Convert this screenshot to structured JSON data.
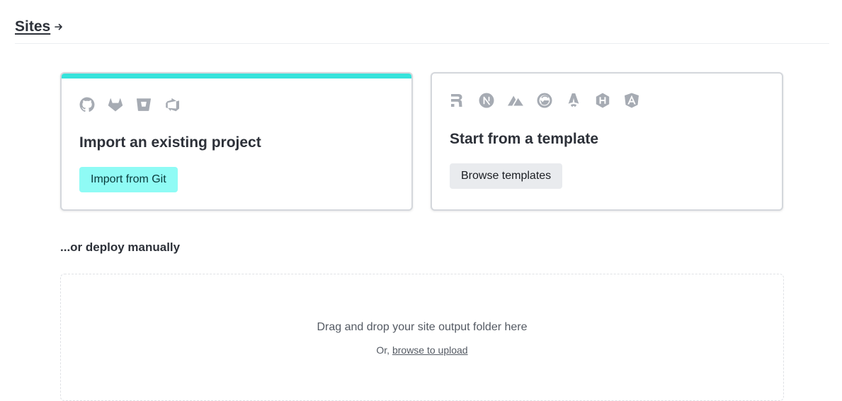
{
  "breadcrumb": {
    "label": "Sites",
    "arrow_icon": "arrow-right-icon"
  },
  "import_card": {
    "accent_color": "#36e3db",
    "icons": [
      "github-icon",
      "gitlab-icon",
      "bitbucket-icon",
      "azure-devops-icon"
    ],
    "title": "Import an existing project",
    "button_label": "Import from Git"
  },
  "template_card": {
    "icons": [
      "remix-icon",
      "nextjs-icon",
      "nuxt-icon",
      "gatsby-icon",
      "astro-icon",
      "hugo-icon",
      "angular-icon"
    ],
    "title": "Start from a template",
    "button_label": "Browse templates"
  },
  "manual": {
    "title": "...or deploy manually",
    "drop_text": "Drag and drop your site output folder here",
    "or_text": "Or,",
    "browse_link": "browse to upload"
  },
  "colors": {
    "icon": "#a6abb3",
    "primary_button": "#8ffbf5",
    "secondary_button": "#e9ebee"
  }
}
